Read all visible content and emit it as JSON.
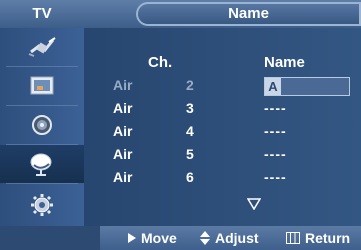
{
  "header": {
    "source_label": "TV",
    "title": "Name"
  },
  "sidebar": {
    "items": [
      {
        "icon": "antenna-plug-icon"
      },
      {
        "icon": "picture-icon"
      },
      {
        "icon": "sound-icon"
      },
      {
        "icon": "channel-satellite-icon",
        "active": true
      },
      {
        "icon": "setup-gear-icon"
      }
    ]
  },
  "table": {
    "headers": {
      "channel": "Ch.",
      "name": "Name"
    },
    "rows": [
      {
        "source": "Air",
        "number": "2",
        "name": "A",
        "state": "editing"
      },
      {
        "source": "Air",
        "number": "3",
        "name": "----"
      },
      {
        "source": "Air",
        "number": "4",
        "name": "----"
      },
      {
        "source": "Air",
        "number": "5",
        "name": "----"
      },
      {
        "source": "Air",
        "number": "6",
        "name": "----"
      }
    ]
  },
  "footer": {
    "move_label": "Move",
    "adjust_label": "Adjust",
    "return_label": "Return"
  },
  "colors": {
    "panel": "#2c4a72",
    "bar": "#5b7ba5",
    "text": "#ffffff",
    "dim_text": "#98abc7"
  }
}
